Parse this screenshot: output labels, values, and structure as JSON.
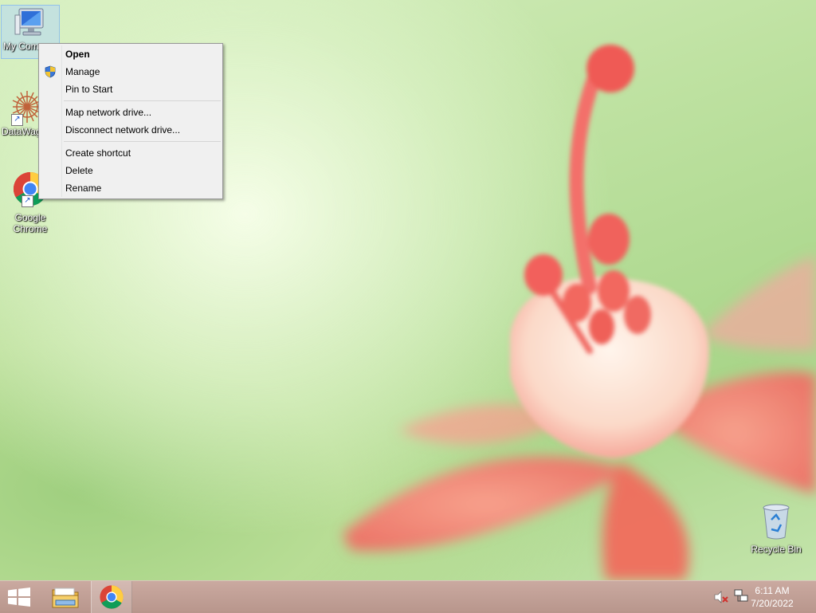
{
  "desktop": {
    "icons": [
      {
        "label": "My Computer",
        "shown_label": "My Com"
      },
      {
        "label": "DataWag"
      },
      {
        "label": "Google Chrome",
        "line1": "Google",
        "line2": "Chrome"
      },
      {
        "label": "Recycle Bin"
      }
    ]
  },
  "context_menu": {
    "items": [
      {
        "label": "Open",
        "bold": true
      },
      {
        "label": "Manage",
        "icon": "uac-shield-icon"
      },
      {
        "label": "Pin to Start"
      },
      {
        "label": "Map network drive..."
      },
      {
        "label": "Disconnect network drive..."
      },
      {
        "label": "Create shortcut"
      },
      {
        "label": "Delete"
      },
      {
        "label": "Rename"
      }
    ]
  },
  "taskbar": {
    "start_icon": "windows-logo-icon",
    "pinned": [
      "file-explorer-icon",
      "chrome-icon"
    ],
    "tray_icons": [
      "volume-muted-icon",
      "network-icon"
    ],
    "time": "6:11 AM",
    "date": "7/20/2022"
  },
  "colors": {
    "taskbar": "#c0a096",
    "menu_bg": "#f0f0f0",
    "wallpaper_flower": "#f07a70"
  }
}
